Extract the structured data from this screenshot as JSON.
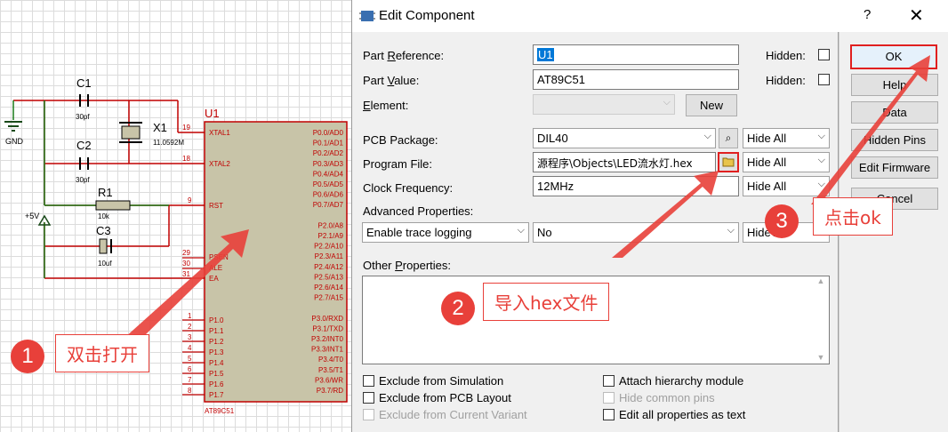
{
  "schematic": {
    "labels": {
      "c1": "C1",
      "c1_val": "30pf",
      "c2": "C2",
      "c2_val": "30pf",
      "x1": "X1",
      "x1_val": "11.0592M",
      "r1": "R1",
      "r1_val": "10k",
      "c3": "C3",
      "c3_val": "10uf",
      "gnd": "GND",
      "vcc": "+5V",
      "u1": "U1",
      "chip": "AT89C51",
      "pin19": "19",
      "pin18": "18",
      "pin9": "9",
      "pin29": "29",
      "pin30": "30",
      "pin31": "31",
      "xtal1": "XTAL1",
      "xtal2": "XTAL2",
      "rst": "RST",
      "psen": "PSEN",
      "ale": "ALE",
      "ea": "EA"
    },
    "right_pins": [
      "P0.0/AD0",
      "P0.1/AD1",
      "P0.2/AD2",
      "P0.3/AD3",
      "P0.4/AD4",
      "P0.5/AD5",
      "P0.6/AD6",
      "P0.7/AD7",
      "",
      "P2.0/A8",
      "P2.1/A9",
      "P2.2/A10",
      "P2.3/A11",
      "P2.4/A12",
      "P2.5/A13",
      "P2.6/A14",
      "P2.7/A15",
      "",
      "P3.0/RXD",
      "P3.1/TXD",
      "P3.2/INT0",
      "P3.3/INT1",
      "P3.4/T0",
      "P3.5/T1",
      "P3.6/WR",
      "P3.7/RD"
    ],
    "left_pins": [
      "P1.0",
      "P1.1",
      "P1.2",
      "P1.3",
      "P1.4",
      "P1.5",
      "P1.6",
      "P1.7"
    ],
    "left_pin_nums": [
      "1",
      "2",
      "3",
      "4",
      "5",
      "6",
      "7",
      "8"
    ]
  },
  "dialog": {
    "title": "Edit Component",
    "help": "?",
    "close": "✕",
    "part_reference": {
      "label_pre": "Part ",
      "label_u": "R",
      "label_post": "eference:",
      "value": "U1"
    },
    "part_value": {
      "label_pre": "Part ",
      "label_u": "V",
      "label_post": "alue:",
      "value": "AT89C51"
    },
    "element": {
      "label_u": "E",
      "label_post": "lement:",
      "value": "",
      "new_button": "New"
    },
    "hidden_label": "Hidden:",
    "pcb_package": {
      "label": "PCB Package:",
      "value": "DIL40",
      "hide": "Hide All"
    },
    "program_file": {
      "label": "Program File:",
      "value": "源程序\\Objects\\LED流水灯.hex",
      "hide": "Hide All"
    },
    "clock_frequency": {
      "label": "Clock Frequency:",
      "value": "12MHz",
      "hide": "Hide All"
    },
    "advanced": {
      "label": "Advanced Properties:",
      "property": "Enable trace logging",
      "value": "No",
      "hide": "Hide All"
    },
    "other": {
      "label_pre": "Other ",
      "label_u": "P",
      "label_post": "roperties:",
      "value": ""
    },
    "checkboxes": {
      "exclude_sim": "Exclude from Simulation",
      "exclude_pcb": "Exclude from PCB Layout",
      "exclude_variant": "Exclude from Current Variant",
      "attach_hier": "Attach hierarchy module",
      "hide_common": "Hide common pins",
      "edit_all": "Edit all properties as text"
    },
    "buttons": {
      "ok": "OK",
      "help": "Help",
      "data": "Data",
      "hidden_pins": "Hidden Pins",
      "edit_firmware": "Edit Firmware",
      "cancel": "Cancel"
    }
  },
  "annotations": {
    "step1": {
      "num": "1",
      "text": "双击打开"
    },
    "step2": {
      "num": "2",
      "text": "导入hex文件"
    },
    "step3": {
      "num": "3",
      "text": "点击ok"
    }
  },
  "colors": {
    "accent_red": "#e8403a",
    "chip_fill": "#c8c4a8",
    "wire": "#c00000",
    "dialog_bg": "#f0f0f0"
  }
}
